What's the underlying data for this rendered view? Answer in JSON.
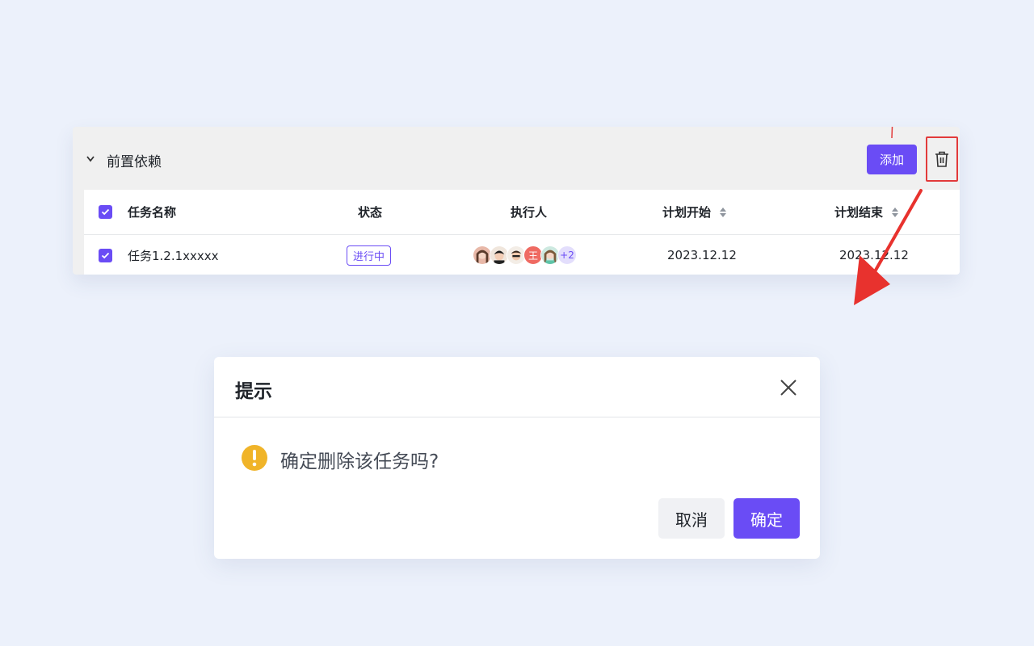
{
  "panel": {
    "title": "前置依赖",
    "add_label": "添加",
    "delete_icon": "trash-icon",
    "collapse_icon": "chevron-down-icon"
  },
  "table": {
    "columns": [
      "任务名称",
      "状态",
      "执行人",
      "计划开始",
      "计划结束"
    ],
    "rows": [
      {
        "selected": true,
        "name": "任务1.2.1xxxxx",
        "status": "进行中",
        "assignees": [
          "avatar-1",
          "avatar-2",
          "avatar-3",
          "王",
          "avatar-5"
        ],
        "assignees_more": "+2",
        "start": "2023.12.12",
        "end": "2023.12.12"
      }
    ],
    "header_checked": true
  },
  "dialog": {
    "title": "提示",
    "message": "确定删除该任务吗?",
    "cancel_label": "取消",
    "confirm_label": "确定",
    "icon": "warning-icon"
  },
  "colors": {
    "accent": "#6a4cf5",
    "annotation_red": "#e23a3a",
    "warning": "#f0b429",
    "background": "#ecf1fb"
  }
}
